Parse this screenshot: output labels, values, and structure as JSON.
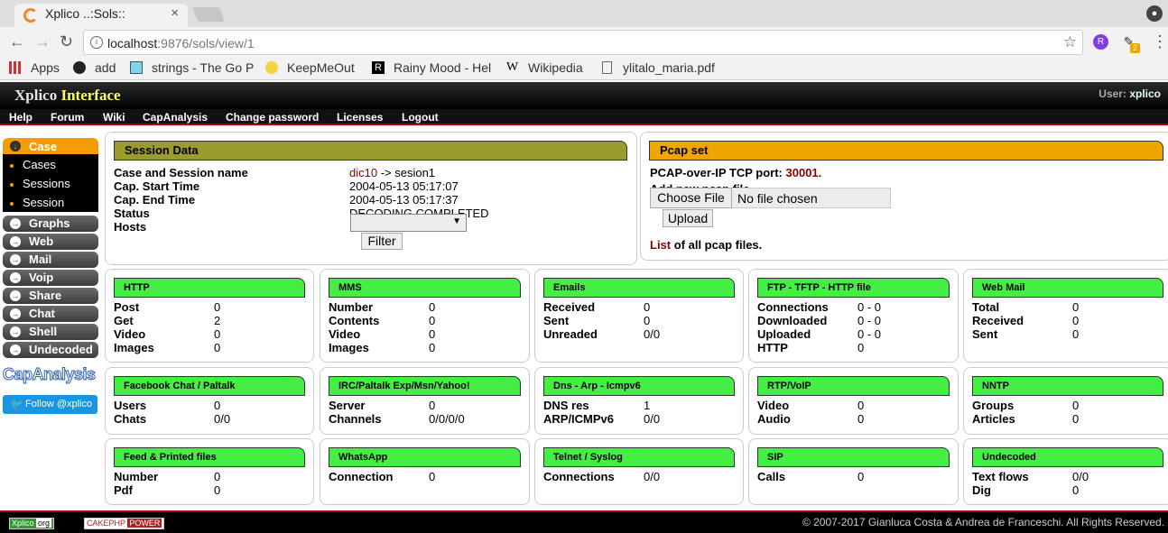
{
  "browser": {
    "tab_title": "Xplico ..:Sols::",
    "tab_close": "×",
    "url_host": "localhost",
    "url_rest": ":9876/sols/view/1",
    "ext_badge": "R",
    "ext_count": "2",
    "bookmarks": [
      "Apps",
      "add",
      "strings - The Go P",
      "KeepMeOut",
      "Rainy Mood - Hel",
      "Wikipedia",
      "ylitalo_maria.pdf"
    ]
  },
  "app": {
    "logo_a": "Xplico",
    "logo_b": "Interface",
    "user_label": "User:",
    "user_name": "xplico",
    "menu": [
      "Help",
      "Forum",
      "Wiki",
      "CapAnalysis",
      "Change password",
      "Licenses",
      "Logout"
    ]
  },
  "sidebar": {
    "head": "Case",
    "subs": [
      "Cases",
      "Sessions",
      "Session"
    ],
    "items": [
      "Graphs",
      "Web",
      "Mail",
      "Voip",
      "Share",
      "Chat",
      "Shell",
      "Undecoded"
    ],
    "caplogo": "CapAnalysis",
    "twitter": "Follow @xplico"
  },
  "session": {
    "title": "Session Data",
    "labels": [
      "Case and Session name",
      "Cap. Start Time",
      "Cap. End Time",
      "Status",
      "Hosts"
    ],
    "case_name": "dic10",
    "session_name": " -> sesion1",
    "start": "2004-05-13 05:17:07",
    "end": "2004-05-13 05:17:37",
    "status": "DECODING COMPLETED",
    "host_selected": "",
    "filter": "Filter"
  },
  "pcap": {
    "title": "Pcap set",
    "port_label": "PCAP-over-IP TCP port:",
    "port": "30001.",
    "add_label": "Add new pcap file.",
    "choose": "Choose File",
    "nofile": "No file chosen",
    "upload": "Upload",
    "list_link": "List",
    "list_rest": " of all pcap files."
  },
  "panels": [
    {
      "title": "HTTP",
      "rows": [
        [
          "Post",
          "0"
        ],
        [
          "Get",
          "2"
        ],
        [
          "Video",
          "0"
        ],
        [
          "Images",
          "0"
        ]
      ]
    },
    {
      "title": "MMS",
      "rows": [
        [
          "Number",
          "0"
        ],
        [
          "Contents",
          "0"
        ],
        [
          "Video",
          "0"
        ],
        [
          "Images",
          "0"
        ]
      ]
    },
    {
      "title": "Emails",
      "rows": [
        [
          "Received",
          "0"
        ],
        [
          "Sent",
          "0"
        ],
        [
          "Unreaded",
          "0/0"
        ]
      ]
    },
    {
      "title": "FTP - TFTP - HTTP file",
      "rows": [
        [
          "Connections",
          "0 - 0"
        ],
        [
          "Downloaded",
          "0 - 0"
        ],
        [
          "Uploaded",
          "0 - 0"
        ],
        [
          "HTTP",
          "0"
        ]
      ]
    },
    {
      "title": "Web Mail",
      "rows": [
        [
          "Total",
          "0"
        ],
        [
          "Received",
          "0"
        ],
        [
          "Sent",
          "0"
        ]
      ]
    },
    {
      "title": "Facebook Chat / Paltalk",
      "rows": [
        [
          "Users",
          "0"
        ],
        [
          "Chats",
          "0/0"
        ]
      ]
    },
    {
      "title": "IRC/Paltalk Exp/Msn/Yahoo!",
      "rows": [
        [
          "Server",
          "0"
        ],
        [
          "Channels",
          "0/0/0/0"
        ]
      ]
    },
    {
      "title": "Dns - Arp - Icmpv6",
      "rows": [
        [
          "DNS res",
          "1"
        ],
        [
          "ARP/ICMPv6",
          "0/0"
        ]
      ]
    },
    {
      "title": "RTP/VoIP",
      "rows": [
        [
          "Video",
          "0"
        ],
        [
          "Audio",
          "0"
        ]
      ]
    },
    {
      "title": "NNTP",
      "rows": [
        [
          "Groups",
          "0"
        ],
        [
          "Articles",
          "0"
        ]
      ]
    },
    {
      "title": "Feed & Printed files",
      "rows": [
        [
          "Number",
          "0"
        ],
        [
          "Pdf",
          "0"
        ]
      ]
    },
    {
      "title": "WhatsApp",
      "rows": [
        [
          "Connection",
          "0"
        ]
      ]
    },
    {
      "title": "Telnet / Syslog",
      "rows": [
        [
          "Connections",
          "0/0"
        ]
      ]
    },
    {
      "title": "SIP",
      "rows": [
        [
          "Calls",
          "0"
        ]
      ]
    },
    {
      "title": "Undecoded",
      "rows": [
        [
          "Text flows",
          "0/0"
        ],
        [
          "Dig",
          "0"
        ]
      ]
    }
  ],
  "footer": {
    "badge1a": "Xplico",
    "badge1b": "org",
    "badge2a": "CAKEPHP",
    "badge2b": "POWER",
    "copyright": "© 2007-2017 Gianluca Costa & Andrea de Franceschi. All Rights Reserved."
  },
  "colors": {
    "accent": "#f49c00",
    "panel_title": "#44ee44",
    "session_title": "#9b9b2e",
    "pcap_title": "#f0a500",
    "case_name": "#8b0000"
  }
}
